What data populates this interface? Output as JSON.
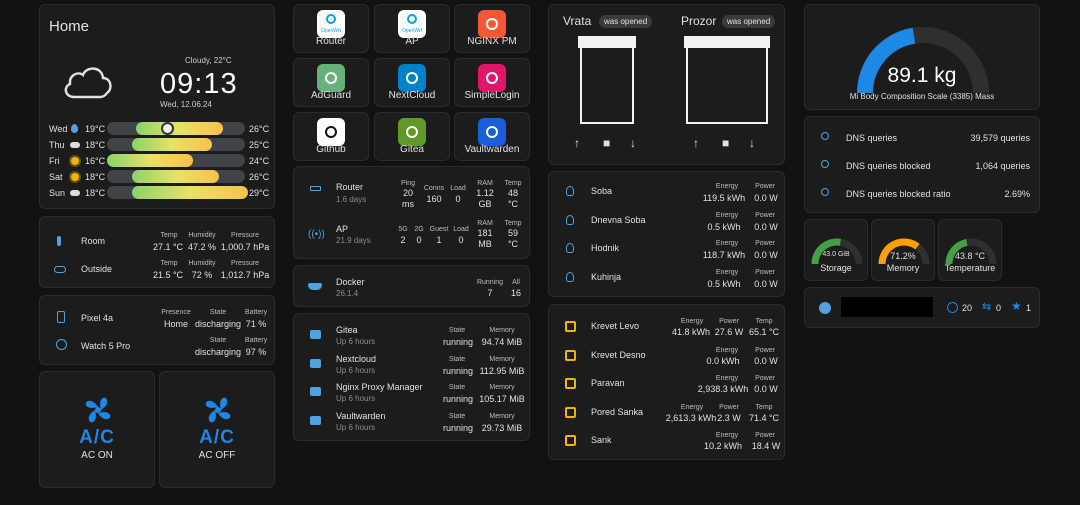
{
  "home": {
    "title": "Home",
    "condition": "Cloudy, 22°C",
    "time": "09:13",
    "date": "Wed, 12.06.24",
    "forecast": [
      {
        "day": "Wed",
        "low": "19°C",
        "high": "26°C",
        "icon": "rain-drop-icon",
        "fill": 0.63,
        "start": 0.21,
        "dot": true
      },
      {
        "day": "Thu",
        "low": "18°C",
        "high": "25°C",
        "icon": "partly-cloudy-icon",
        "fill": 0.58,
        "start": 0.18
      },
      {
        "day": "Fri",
        "low": "16°C",
        "high": "24°C",
        "icon": "sun-icon",
        "fill": 0.62,
        "start": 0.0
      },
      {
        "day": "Sat",
        "low": "18°C",
        "high": "26°C",
        "icon": "sun-icon",
        "fill": 0.63,
        "start": 0.18
      },
      {
        "day": "Sun",
        "low": "18°C",
        "high": "29°C",
        "icon": "partly-cloudy-icon",
        "fill": 0.84,
        "start": 0.18
      }
    ]
  },
  "climate": {
    "headers": {
      "temp": "Temp",
      "humidity": "Humidity",
      "pressure": "Pressure"
    },
    "rows": [
      {
        "name": "Room",
        "icon": "thermometer-icon",
        "temp": "27.1 °C",
        "humidity": "47.2 %",
        "pressure": "1,000.7 hPa"
      },
      {
        "name": "Outside",
        "icon": "cloud-icon",
        "temp": "21.5 °C",
        "humidity": "72 %",
        "pressure": "1,012.7 hPa"
      }
    ]
  },
  "devices": {
    "headers": {
      "presence": "Presence",
      "state": "State",
      "battery": "Battery"
    },
    "rows": [
      {
        "name": "Pixel 4a",
        "icon": "phone-icon",
        "presence": "Home",
        "state": "discharging",
        "battery": "71 %"
      },
      {
        "name": "Watch 5 Pro",
        "icon": "watch-icon",
        "presence": "",
        "state": "discharging",
        "battery": "97 %"
      }
    ]
  },
  "ac": [
    {
      "label": "AC ON",
      "glyph": "A/C"
    },
    {
      "label": "AC OFF",
      "glyph": "A/C"
    }
  ],
  "apps": [
    {
      "name": "Router",
      "badge": "OpenWrt",
      "bg": "#ffffff",
      "fg": "#00a3e0"
    },
    {
      "name": "AP",
      "badge": "OpenWrt",
      "bg": "#ffffff",
      "fg": "#00a3e0"
    },
    {
      "name": "NGINX PM",
      "badge": "",
      "bg": "#f15833",
      "fg": "#ffffff"
    },
    {
      "name": "AdGuard",
      "badge": "",
      "bg": "#67b279",
      "fg": "#ffffff"
    },
    {
      "name": "NextCloud",
      "badge": "",
      "bg": "#0082c9",
      "fg": "#ffffff"
    },
    {
      "name": "SimpleLogin",
      "badge": "",
      "bg": "#e3156a",
      "fg": "#ffffff"
    },
    {
      "name": "Github",
      "badge": "",
      "bg": "#ffffff",
      "fg": "#111111"
    },
    {
      "name": "Gitea",
      "badge": "",
      "bg": "#609926",
      "fg": "#ffffff"
    },
    {
      "name": "Vaultwarden",
      "badge": "",
      "bg": "#175ddc",
      "fg": "#ffffff"
    }
  ],
  "network": {
    "router": {
      "name": "Router",
      "uptime": "1.6 days",
      "ping_h": "Ping",
      "ping": "20",
      "ping_unit": "ms",
      "conns_h": "Conns",
      "conns": "160",
      "load_h": "Load",
      "load": "0",
      "ram_h": "RAM",
      "ram": "1.12",
      "ram_unit": "GB",
      "temp_h": "Temp",
      "temp": "48",
      "temp_unit": "°C"
    },
    "ap": {
      "name": "AP",
      "uptime": "21.9 days",
      "g5_h": "5G",
      "g5": "2",
      "g2_h": "2G",
      "g2": "0",
      "guest_h": "Guest",
      "guest": "1",
      "load_h": "Load",
      "load": "0",
      "ram_h": "RAM",
      "ram": "181",
      "ram_unit": "MB",
      "temp_h": "Temp",
      "temp": "59",
      "temp_unit": "°C"
    }
  },
  "docker": {
    "name": "Docker",
    "version": "26.1.4",
    "running_h": "Running",
    "running": "7",
    "all_h": "All",
    "all": "16"
  },
  "containers": {
    "headers": {
      "state": "State",
      "memory": "Memory"
    },
    "rows": [
      {
        "name": "Gitea",
        "uptime": "Up 6 hours",
        "state": "running",
        "memory": "94.74 MiB"
      },
      {
        "name": "Nextcloud",
        "uptime": "Up 6 hours",
        "state": "running",
        "memory": "112.95 MiB"
      },
      {
        "name": "Nginx Proxy Manager",
        "uptime": "Up 6 hours",
        "state": "running",
        "memory": "105.17 MiB"
      },
      {
        "name": "Vaultwarden",
        "uptime": "Up 6 hours",
        "state": "running",
        "memory": "29.73 MiB"
      }
    ]
  },
  "covers": [
    {
      "name": "Vrata",
      "status": "was opened"
    },
    {
      "name": "Prozor",
      "status": "was opened"
    }
  ],
  "lights": {
    "headers": {
      "energy": "Energy",
      "power": "Power"
    },
    "rows": [
      {
        "name": "Soba",
        "energy": "119.5 kWh",
        "power": "0.0 W"
      },
      {
        "name": "Dnevna Soba",
        "energy": "0.5 kWh",
        "power": "0.0 W"
      },
      {
        "name": "Hodnik",
        "energy": "118.7 kWh",
        "power": "0.0 W"
      },
      {
        "name": "Kuhinja",
        "energy": "0.5 kWh",
        "power": "0.0 W"
      }
    ]
  },
  "plugs": {
    "headers": {
      "energy": "Energy",
      "power": "Power",
      "temp": "Temp"
    },
    "rows": [
      {
        "name": "Krevet Levo",
        "energy": "41.8 kWh",
        "power": "27.6 W",
        "temp": "65.1 °C"
      },
      {
        "name": "Krevet Desno",
        "energy": "",
        "power": "0.0 kWh",
        "temp": "0.0 W"
      },
      {
        "name": "Paravan",
        "energy": "",
        "power": "2,938.3 kWh",
        "temp": "0.0 W"
      },
      {
        "name": "Pored Sanka",
        "energy": "2,613.3 kWh",
        "power": "2.3 W",
        "temp": "71.4 °C"
      },
      {
        "name": "Sank",
        "energy": "",
        "power": "10.2 kWh",
        "temp": "18.4 W"
      }
    ]
  },
  "scale": {
    "value": "89.1 kg",
    "label": "Mi Body Composition Scale (3385) Mass",
    "fraction": 0.45,
    "color": "#1e88e5"
  },
  "dns": [
    {
      "name": "DNS queries",
      "value": "39,579 queries"
    },
    {
      "name": "DNS queries blocked",
      "value": "1,064 queries"
    },
    {
      "name": "DNS queries blocked ratio",
      "value": "2.69%"
    }
  ],
  "gauges": [
    {
      "label": "Storage",
      "value": "43.0 GiB",
      "fraction": 0.55,
      "color": "#43a047"
    },
    {
      "label": "Memory",
      "value": "71.2%",
      "fraction": 0.71,
      "color": "#ffa000"
    },
    {
      "label": "Temperature",
      "value": "43.8 °C",
      "fraction": 0.44,
      "color": "#43a047"
    }
  ],
  "github": {
    "issues": "20",
    "prs": "0",
    "stars": "1"
  }
}
